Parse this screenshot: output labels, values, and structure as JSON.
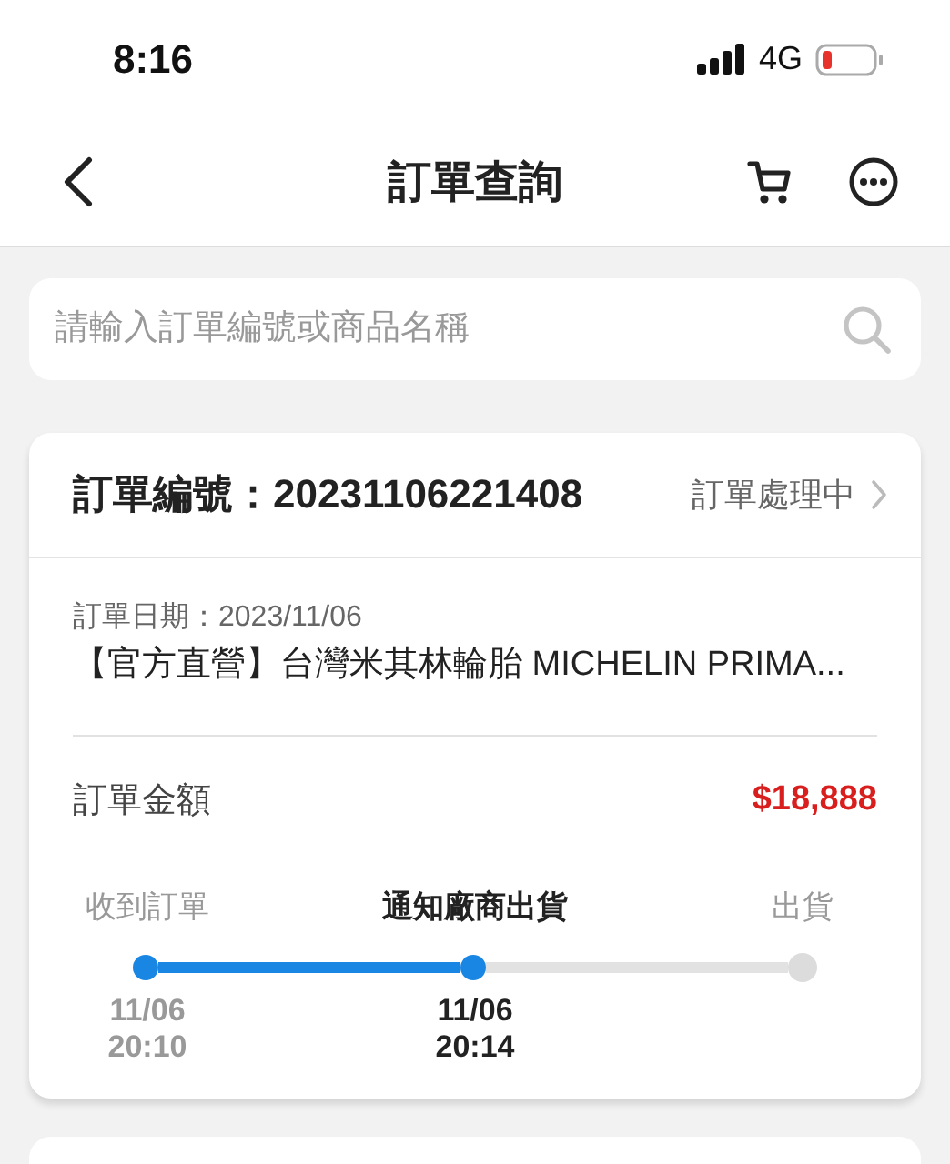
{
  "status_bar": {
    "time": "8:16",
    "network": "4G"
  },
  "nav": {
    "title": "訂單查詢"
  },
  "search": {
    "placeholder": "請輸入訂單編號或商品名稱"
  },
  "orders": [
    {
      "number_label": "訂單編號：",
      "number": "20231106221408",
      "status": "訂單處理中",
      "date": "訂單日期：2023/11/06",
      "product": "【官方直營】台灣米其林輪胎 MICHELIN PRIMA...",
      "amount_label": "訂單金額",
      "amount": "$18,888",
      "progress": {
        "steps": [
          {
            "label": "收到訂單",
            "date": "11/06",
            "time": "20:10",
            "reached": true,
            "current": false
          },
          {
            "label": "通知廠商出貨",
            "date": "11/06",
            "time": "20:14",
            "reached": true,
            "current": true
          },
          {
            "label": "出貨",
            "reached": false,
            "current": false
          }
        ]
      }
    }
  ]
}
